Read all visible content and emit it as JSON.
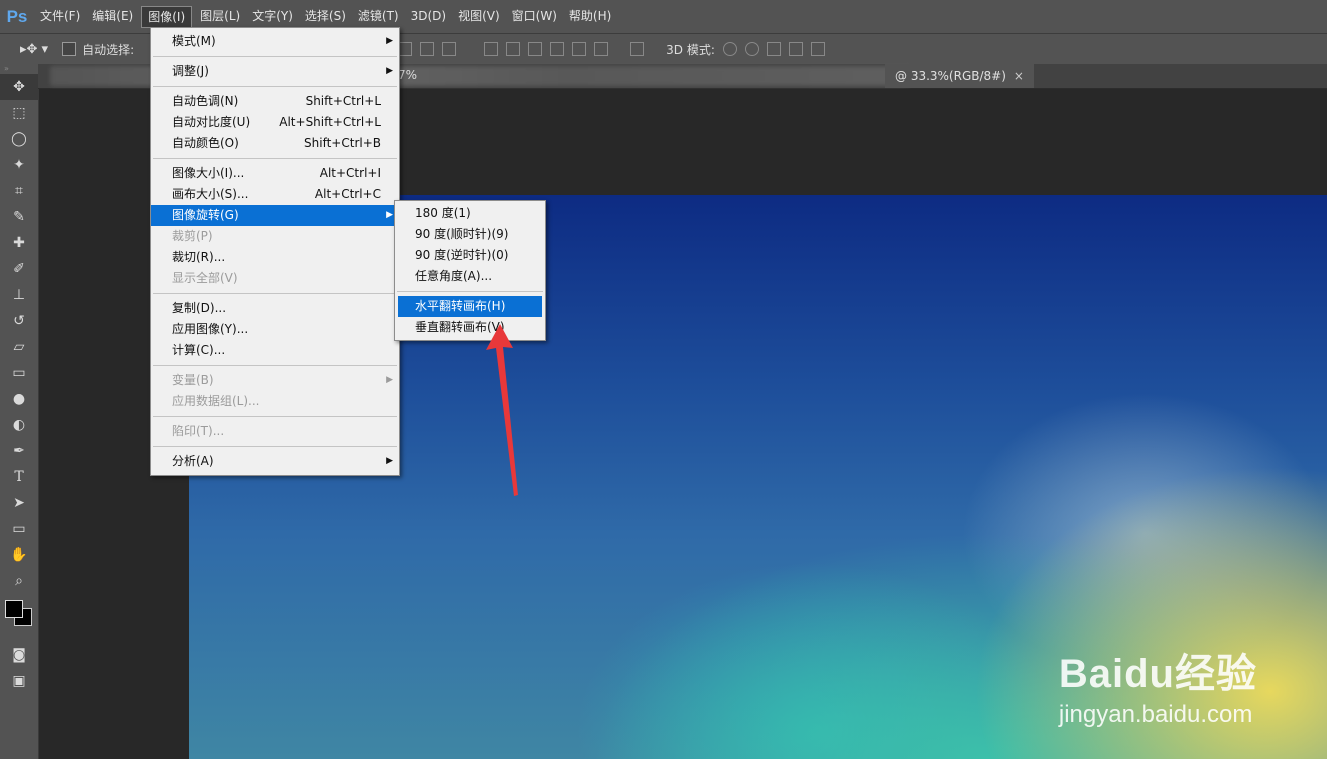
{
  "app": {
    "logo": "Ps"
  },
  "menubar": {
    "items": [
      "文件(F)",
      "编辑(E)",
      "图像(I)",
      "图层(L)",
      "文字(Y)",
      "选择(S)",
      "滤镜(T)",
      "3D(D)",
      "视图(V)",
      "窗口(W)",
      "帮助(H)"
    ],
    "active": "图像(I)"
  },
  "options_bar": {
    "auto_select_label": "自动选择:",
    "mode_3d_label": "3D 模式:"
  },
  "document": {
    "tab_title": "@ 33.3%(RGB/8#)",
    "tab_fragment": "7%"
  },
  "image_menu": {
    "items": [
      {
        "label": "模式(M)",
        "shortcut": "",
        "submenu": true,
        "disabled": false
      },
      {
        "label": "调整(J)",
        "shortcut": "",
        "submenu": true,
        "disabled": false
      },
      {
        "label": "自动色调(N)",
        "shortcut": "Shift+Ctrl+L",
        "disabled": false
      },
      {
        "label": "自动对比度(U)",
        "shortcut": "Alt+Shift+Ctrl+L",
        "disabled": false
      },
      {
        "label": "自动颜色(O)",
        "shortcut": "Shift+Ctrl+B",
        "disabled": false
      },
      {
        "label": "图像大小(I)...",
        "shortcut": "Alt+Ctrl+I",
        "disabled": false
      },
      {
        "label": "画布大小(S)...",
        "shortcut": "Alt+Ctrl+C",
        "disabled": false
      },
      {
        "label": "图像旋转(G)",
        "shortcut": "",
        "submenu": true,
        "highlighted": true
      },
      {
        "label": "裁剪(P)",
        "disabled": true
      },
      {
        "label": "裁切(R)...",
        "disabled": false
      },
      {
        "label": "显示全部(V)",
        "disabled": true
      },
      {
        "label": "复制(D)...",
        "disabled": false
      },
      {
        "label": "应用图像(Y)...",
        "disabled": false
      },
      {
        "label": "计算(C)...",
        "disabled": false
      },
      {
        "label": "变量(B)",
        "submenu": true,
        "disabled": true
      },
      {
        "label": "应用数据组(L)...",
        "disabled": true
      },
      {
        "label": "陷印(T)...",
        "disabled": true
      },
      {
        "label": "分析(A)",
        "submenu": true,
        "disabled": false
      }
    ]
  },
  "rotate_submenu": {
    "items": [
      {
        "label": "180 度(1)"
      },
      {
        "label": "90 度(顺时针)(9)"
      },
      {
        "label": "90 度(逆时针)(0)"
      },
      {
        "label": "任意角度(A)..."
      },
      {
        "label": "水平翻转画布(H)",
        "highlighted": true
      },
      {
        "label": "垂直翻转画布(V)"
      }
    ]
  },
  "watermark": {
    "main": "Baidu经验",
    "sub": "jingyan.baidu.com"
  },
  "colors": {
    "menubar": "#535353",
    "highlight": "#0a70d4",
    "arrow": "#e8383a",
    "logo": "#5fa8ee"
  }
}
